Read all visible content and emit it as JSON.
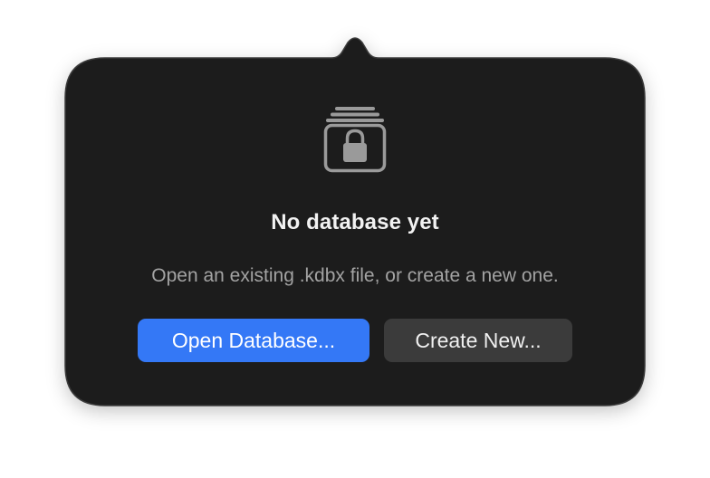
{
  "empty_state": {
    "icon": "locked-database-icon",
    "title": "No database yet",
    "subtitle": "Open an existing .kdbx file, or create a new one."
  },
  "actions": {
    "open_label": "Open Database...",
    "create_label": "Create New..."
  },
  "colors": {
    "popover_background": "#1e1e1e",
    "primary_button": "#3478f6",
    "secondary_button": "#3b3b3b",
    "title_text": "#f2f2f2",
    "subtitle_text": "#a3a3a3",
    "icon": "#9a9a9a"
  }
}
